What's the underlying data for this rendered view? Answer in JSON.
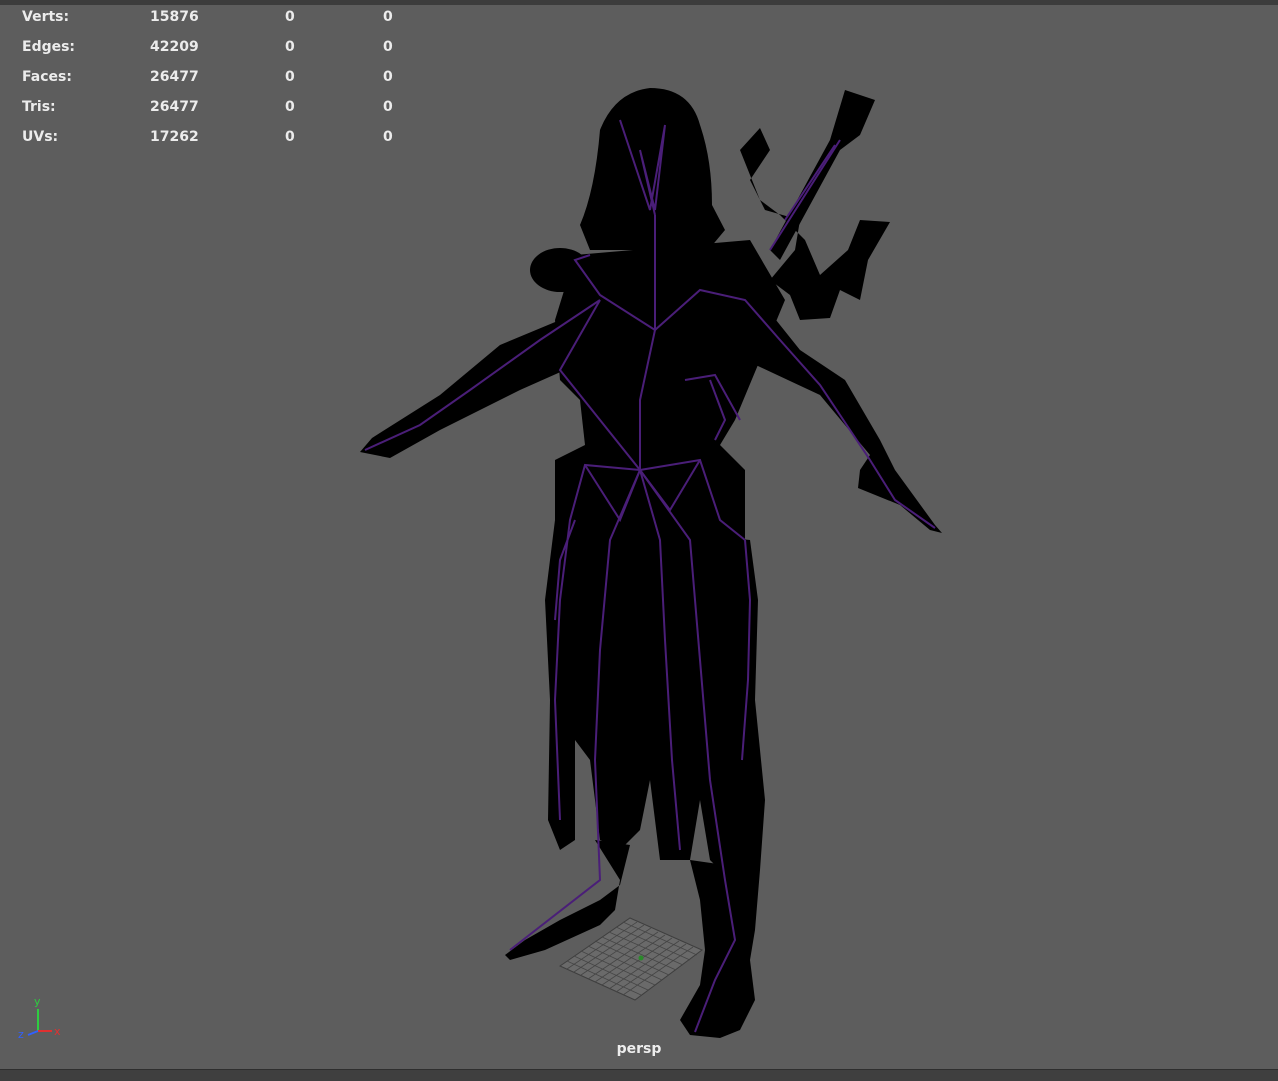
{
  "hud": {
    "rows": [
      {
        "label": "Verts:",
        "v1": "15876",
        "v2": "0",
        "v3": "0"
      },
      {
        "label": "Edges:",
        "v1": "42209",
        "v2": "0",
        "v3": "0"
      },
      {
        "label": "Faces:",
        "v1": "26477",
        "v2": "0",
        "v3": "0"
      },
      {
        "label": "Tris:",
        "v1": "26477",
        "v2": "0",
        "v3": "0"
      },
      {
        "label": "UVs:",
        "v1": "17262",
        "v2": "0",
        "v3": "0"
      }
    ]
  },
  "viewport": {
    "camera_name": "persp",
    "background": "#5d5d5d",
    "model_fill": "#000000",
    "wire_color": "#4a1e78"
  },
  "axis_gizmo": {
    "y_label": "y",
    "z_label": "z",
    "x_label": "x",
    "y_color": "#2ecc40",
    "x_color": "#e03030",
    "z_color": "#3060ff"
  }
}
